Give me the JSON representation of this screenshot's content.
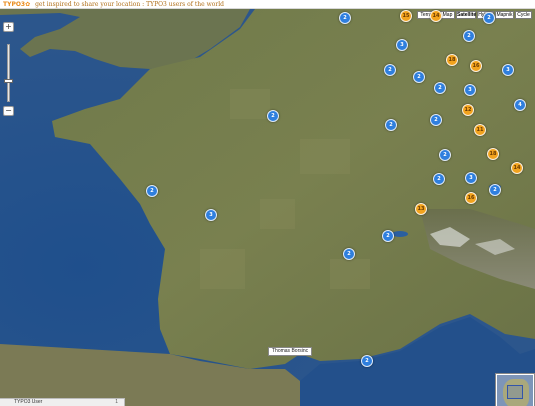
{
  "header": {
    "logo_text": "TYPO3",
    "logo_mark": "✿",
    "tagline": "get inspired to share your location : TYPO3 users of the world"
  },
  "map_types": [
    {
      "label": "Terrain",
      "active": false
    },
    {
      "label": "Map",
      "active": false
    },
    {
      "label": "Satellite",
      "active": true
    },
    {
      "label": "Hybrid",
      "active": false
    },
    {
      "label": "Mapnik",
      "active": false
    },
    {
      "label": "Cycle",
      "active": false
    }
  ],
  "zoom": {
    "in_label": "+",
    "out_label": "−",
    "level_fraction": 0.35
  },
  "place_label": "Thomas Borsinc",
  "status": {
    "title": "TYPO3 User",
    "count": "1"
  },
  "markers": [
    {
      "color": "blue",
      "label": "2"
    },
    {
      "color": "blue",
      "label": "2"
    },
    {
      "color": "yellow",
      "label": "15"
    },
    {
      "color": "yellow",
      "label": "14"
    },
    {
      "color": "blue",
      "label": "3"
    },
    {
      "color": "blue",
      "label": "2"
    },
    {
      "color": "yellow",
      "label": "18"
    },
    {
      "color": "yellow",
      "label": "16"
    },
    {
      "color": "blue",
      "label": "2"
    },
    {
      "color": "blue",
      "label": "2"
    },
    {
      "color": "blue",
      "label": "3"
    },
    {
      "color": "blue",
      "label": "2"
    },
    {
      "color": "blue",
      "label": "3"
    },
    {
      "color": "blue",
      "label": "4"
    },
    {
      "color": "yellow",
      "label": "12"
    },
    {
      "color": "blue",
      "label": "2"
    },
    {
      "color": "blue",
      "label": "2"
    },
    {
      "color": "blue",
      "label": "2"
    },
    {
      "color": "yellow",
      "label": "11"
    },
    {
      "color": "blue",
      "label": "2"
    },
    {
      "color": "yellow",
      "label": "18"
    },
    {
      "color": "blue",
      "label": "3"
    },
    {
      "color": "yellow",
      "label": "14"
    },
    {
      "color": "blue",
      "label": "2"
    },
    {
      "color": "blue",
      "label": "2"
    },
    {
      "color": "yellow",
      "label": "16"
    },
    {
      "color": "blue",
      "label": "2"
    },
    {
      "color": "yellow",
      "label": "13"
    },
    {
      "color": "blue",
      "label": "3"
    },
    {
      "color": "blue",
      "label": "2"
    },
    {
      "color": "blue",
      "label": "2"
    },
    {
      "color": "blue",
      "label": "2"
    },
    {
      "color": "blue",
      "label": "2"
    }
  ]
}
